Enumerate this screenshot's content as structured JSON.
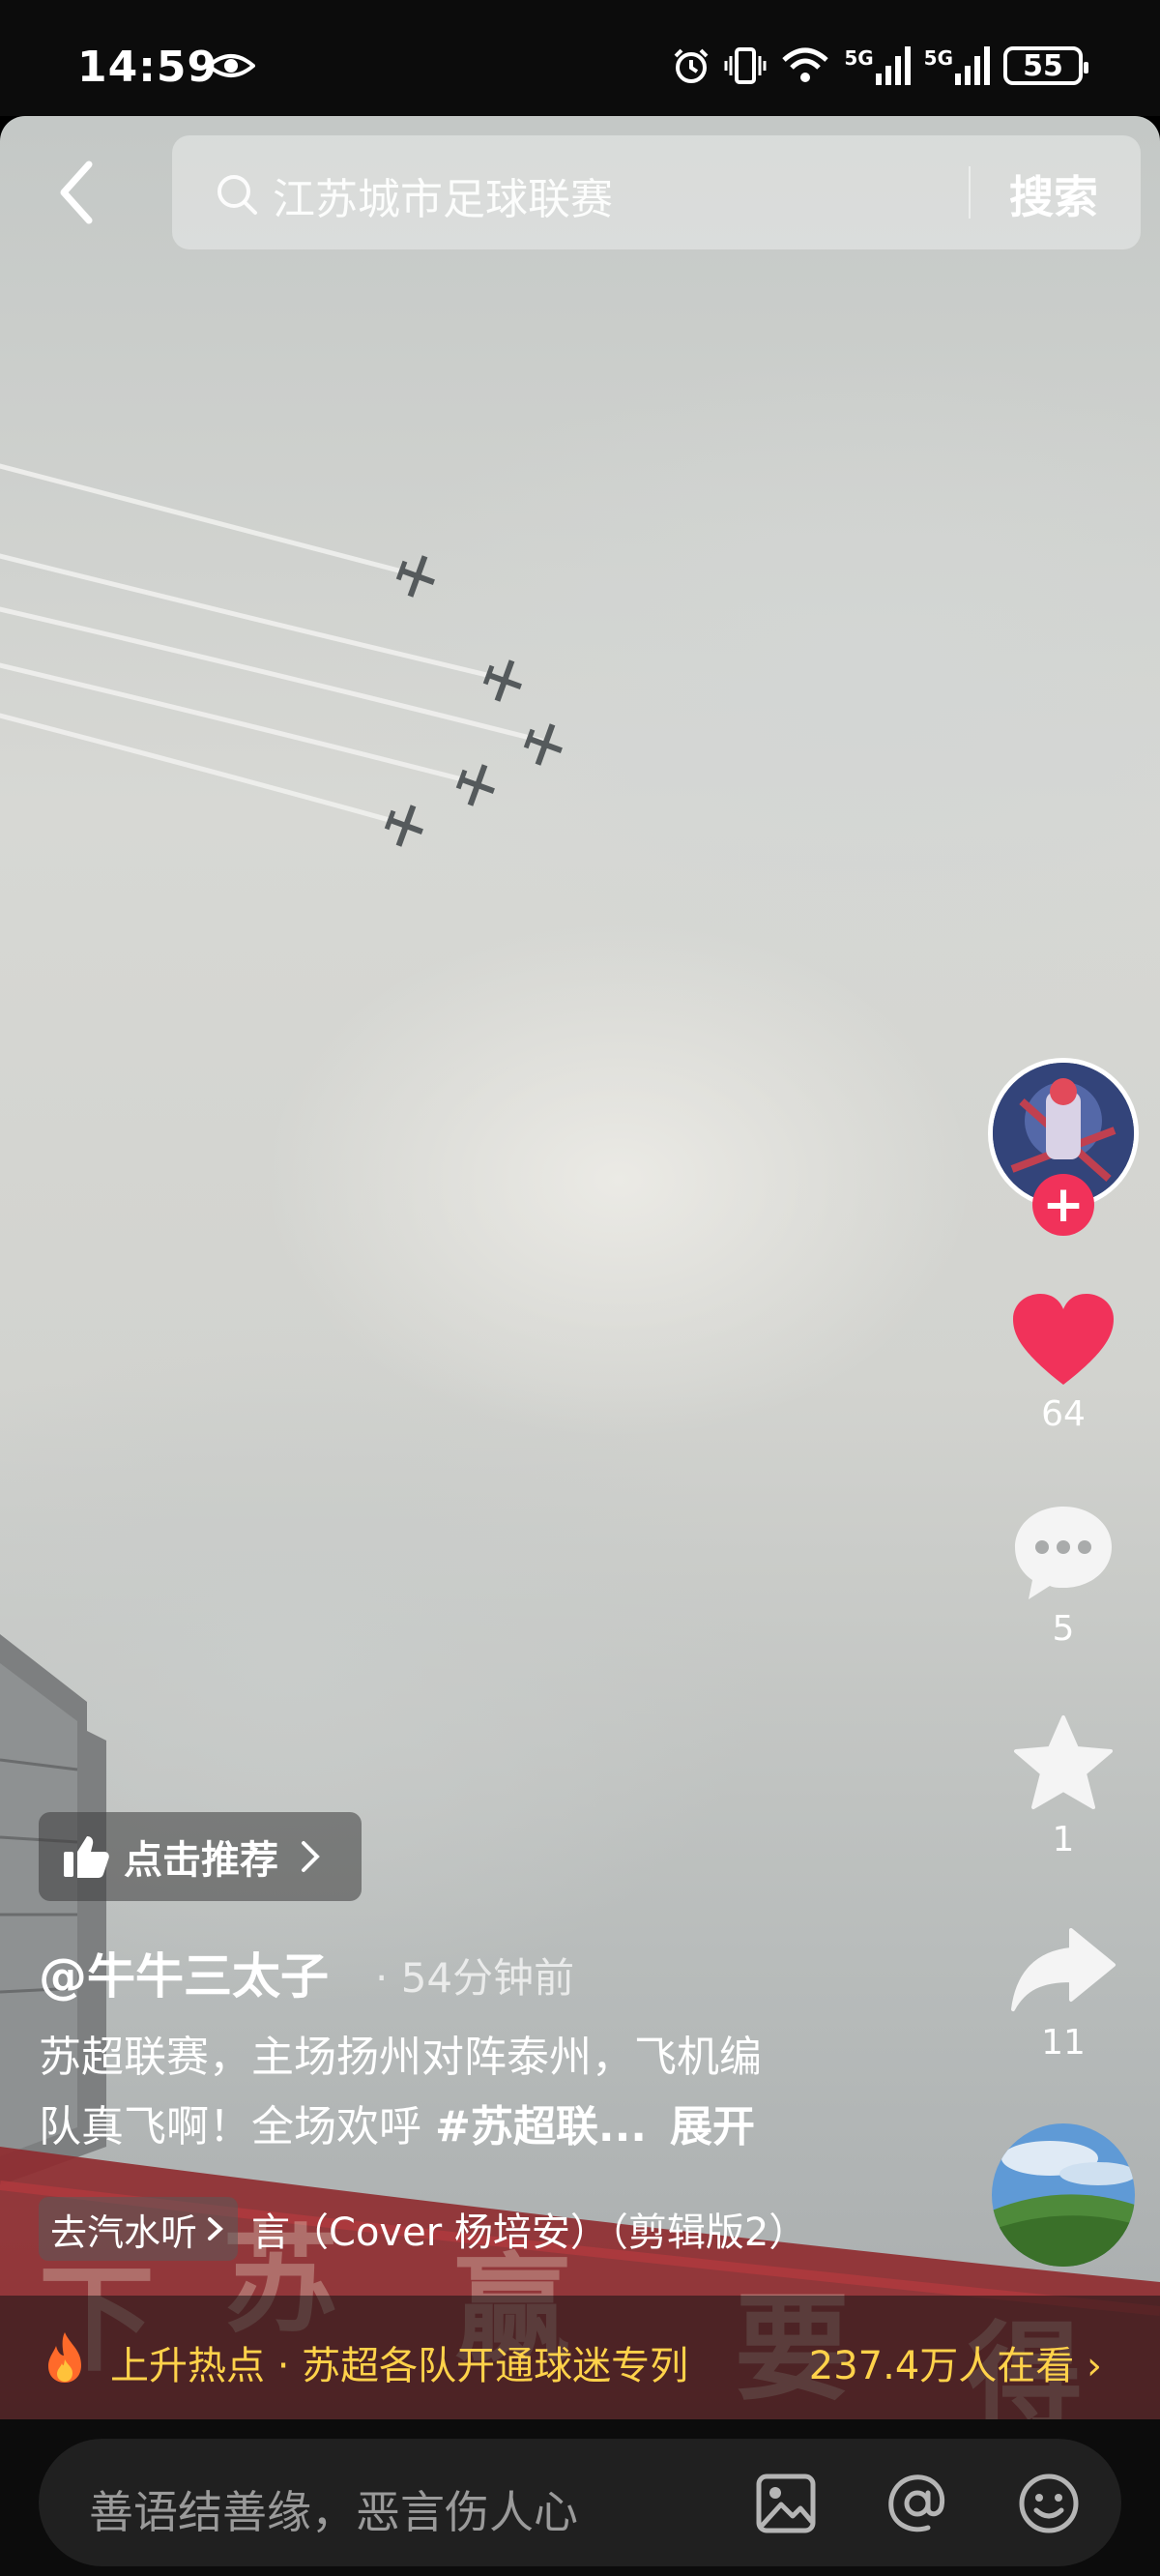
{
  "status_bar": {
    "time": "14:59",
    "signal1": "5G",
    "signal2": "5G",
    "battery": "55"
  },
  "search": {
    "query": "江苏城市足球联赛",
    "button": "搜索"
  },
  "actions": {
    "likes": "64",
    "comments": "5",
    "favorites": "1",
    "shares": "11",
    "follow": "+"
  },
  "video": {
    "recommend_label": "点击推荐",
    "author": "@牛牛三太子",
    "time_ago": "· 54分钟前",
    "desc_line1": "苏超联赛，主场扬州对阵泰州，飞机编",
    "desc_line2": "队真飞啊！全场欢呼 ",
    "hashtag": "#苏超联...",
    "expand": "展开"
  },
  "music": {
    "chip_label": "去汽水听",
    "title": "言（Cover 杨培安）（剪辑版2）"
  },
  "hot": {
    "text": "上升热点 · 苏超各队开通球迷专列",
    "count": "237.4万人在看 ›"
  },
  "comment": {
    "placeholder": "善语结善缘，恶言伤人心"
  },
  "colors": {
    "like": "#f1325a",
    "hot_text": "#ffd24a"
  }
}
